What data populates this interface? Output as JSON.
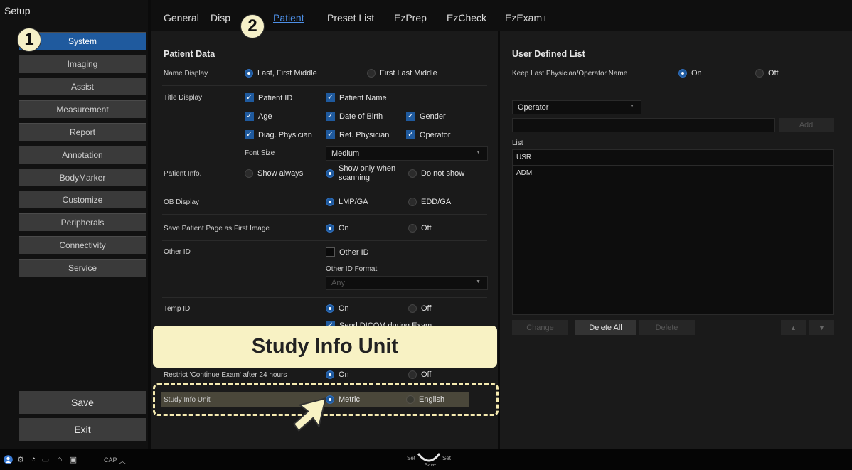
{
  "setup_title": "Setup",
  "sidebar": {
    "items": [
      {
        "label": "System",
        "active": true
      },
      {
        "label": "Imaging"
      },
      {
        "label": "Assist"
      },
      {
        "label": "Measurement"
      },
      {
        "label": "Report"
      },
      {
        "label": "Annotation"
      },
      {
        "label": "BodyMarker"
      },
      {
        "label": "Customize"
      },
      {
        "label": "Peripherals"
      },
      {
        "label": "Connectivity"
      },
      {
        "label": "Service"
      }
    ],
    "save_label": "Save",
    "exit_label": "Exit"
  },
  "tabs": [
    {
      "label": "General"
    },
    {
      "label": "Disp"
    },
    {
      "label": "Patient",
      "active": true
    },
    {
      "label": "Preset List"
    },
    {
      "label": "EzPrep"
    },
    {
      "label": "EzCheck"
    },
    {
      "label": "EzExam+"
    }
  ],
  "badges": {
    "one": "1",
    "two": "2"
  },
  "patient": {
    "section_title": "Patient Data",
    "name_display": {
      "label": "Name Display",
      "opt1": "Last, First Middle",
      "opt2": "First Last Middle",
      "selected": "opt1"
    },
    "title_display": {
      "label": "Title Display",
      "patient_id": "Patient ID",
      "patient_name": "Patient Name",
      "age": "Age",
      "date_of_birth": "Date of Birth",
      "gender": "Gender",
      "diag_physician": "Diag. Physician",
      "ref_physician": "Ref. Physician",
      "operator": "Operator",
      "font_size_label": "Font Size",
      "font_size_value": "Medium"
    },
    "patient_info": {
      "label": "Patient Info.",
      "opt1": "Show always",
      "opt2_line1": "Show only when",
      "opt2_line2": "scanning",
      "opt3": "Do not show",
      "selected": "opt2"
    },
    "ob_display": {
      "label": "OB Display",
      "opt1": "LMP/GA",
      "opt2": "EDD/GA",
      "selected": "opt1"
    },
    "save_first_image": {
      "label": "Save Patient Page as First Image",
      "opt1": "On",
      "opt2": "Off",
      "selected": "opt1"
    },
    "other_id": {
      "label": "Other ID",
      "checkbox": "Other ID",
      "format_label": "Other ID Format",
      "format_value": "Any"
    },
    "temp_id": {
      "label": "Temp ID",
      "opt1": "On",
      "opt2": "Off",
      "selected": "opt1",
      "send_dicom": "Send DICOM during Exam"
    },
    "restrict_continue": {
      "label": "Restrict 'Continue Exam' after 24 hours",
      "opt1": "On",
      "opt2": "Off",
      "selected": "opt1"
    },
    "study_info_unit": {
      "label": "Study Info Unit",
      "opt1": "Metric",
      "opt2": "English",
      "selected": "opt1"
    }
  },
  "callout": "Study Info Unit",
  "user_list": {
    "section_title": "User Defined List",
    "keep_last_label": "Keep Last Physician/Operator Name",
    "on": "On",
    "off": "Off",
    "category_value": "Operator",
    "add_label": "Add",
    "list_label": "List",
    "items": [
      "USR",
      "ADM"
    ],
    "change_label": "Change",
    "delete_all_label": "Delete All",
    "delete_label": "Delete"
  },
  "statusbar": {
    "cap_label": "CAP",
    "set_left": "Set",
    "set_right": "Set",
    "save_sub": "Save"
  },
  "colors": {
    "accent": "#1f5a9e",
    "highlight": "#f8f2c4",
    "tab_active": "#4d8fe6"
  }
}
